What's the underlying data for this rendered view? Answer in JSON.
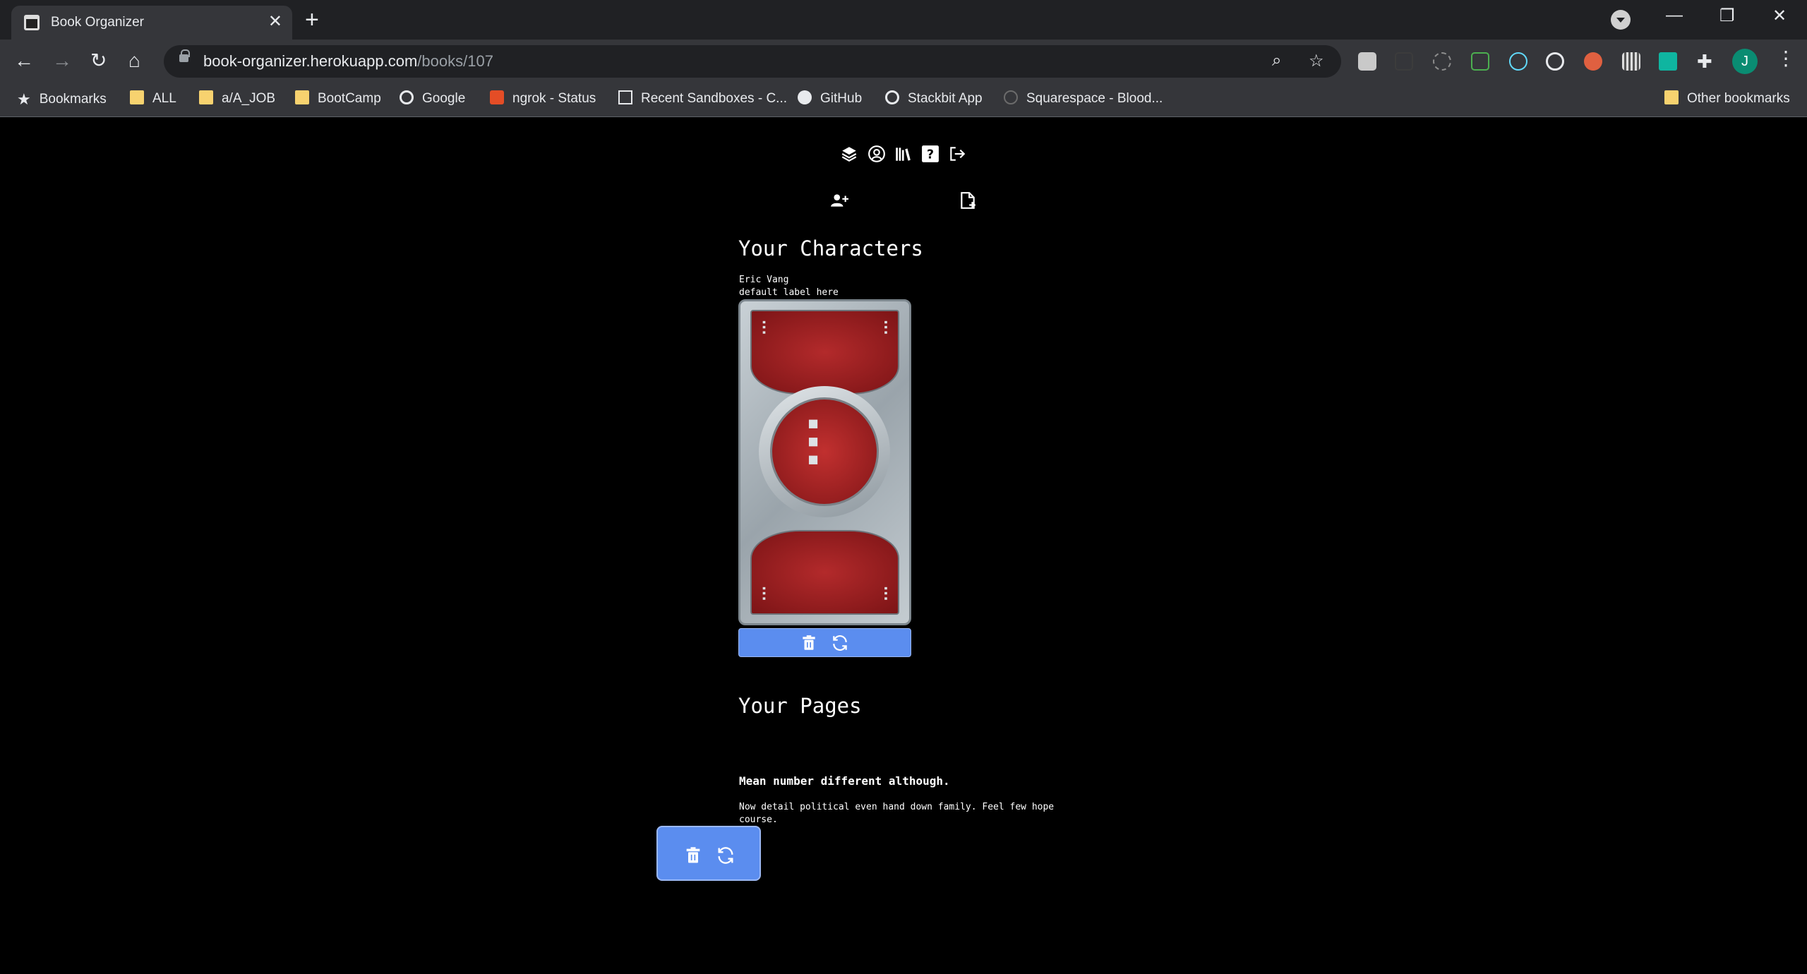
{
  "browser": {
    "tab_title": "Book Organizer",
    "tab_close": "✕",
    "new_tab": "+",
    "url_host": "book-organizer.herokuapp.com",
    "url_path": "/books/107",
    "win_min": "—",
    "win_restore": "❐",
    "win_close": "✕",
    "avatar_letter": "J"
  },
  "bookmarks": [
    {
      "label": "Bookmarks",
      "icon": "star-icon"
    },
    {
      "label": "ALL",
      "icon": "folder-icon"
    },
    {
      "label": "a/A_JOB",
      "icon": "folder-icon"
    },
    {
      "label": "BootCamp",
      "icon": "folder-icon"
    },
    {
      "label": "Google",
      "icon": "globe-icon"
    },
    {
      "label": "ngrok - Status",
      "icon": "ngrok-icon"
    },
    {
      "label": "Recent Sandboxes - C...",
      "icon": "codesandbox-icon"
    },
    {
      "label": "GitHub",
      "icon": "github-icon"
    },
    {
      "label": "Stackbit App",
      "icon": "globe-icon"
    },
    {
      "label": "Squarespace - Blood...",
      "icon": "squarespace-icon"
    },
    {
      "label": "Other bookmarks",
      "icon": "folder-icon"
    }
  ],
  "nav": {
    "icons": [
      "layers-icon",
      "user-circle-icon",
      "library-icon",
      "help-icon",
      "logout-icon"
    ],
    "help_label": "?"
  },
  "actions": {
    "add_character_icon": "user-plus-icon",
    "add_page_icon": "file-plus-icon"
  },
  "characters": {
    "heading": "Your Characters",
    "items": [
      {
        "name": "Eric Vang",
        "label": "default label here"
      }
    ]
  },
  "pages": {
    "heading": "Your Pages",
    "items": [
      {
        "title": "Mean number different although.",
        "body": "Now detail political even hand down family. Feel few hope course."
      }
    ]
  },
  "colors": {
    "accent": "#5b8def",
    "background": "#000000"
  }
}
